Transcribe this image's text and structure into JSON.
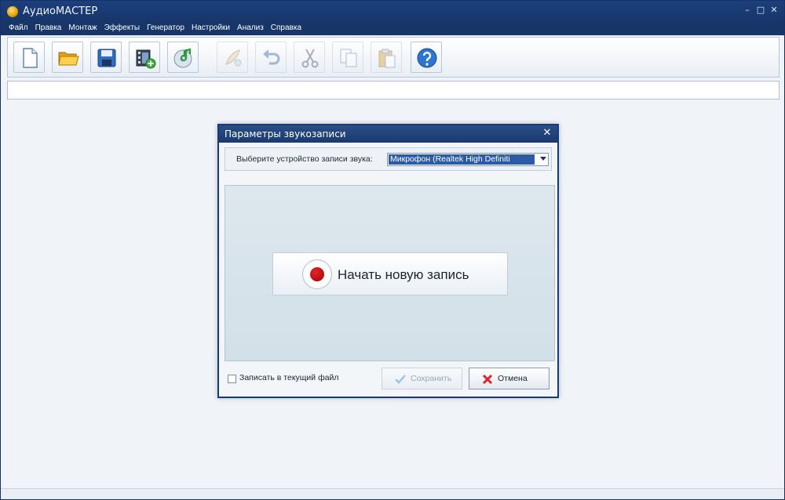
{
  "window": {
    "title": "АудиоМАСТЕР",
    "controls": [
      "–",
      "□",
      "✕"
    ]
  },
  "menu": [
    "Файл",
    "Правка",
    "Монтаж",
    "Эффекты",
    "Генератор",
    "Настройки",
    "Анализ",
    "Справка"
  ],
  "toolbar": {
    "buttons": [
      {
        "icon": "new-file-icon",
        "enabled": true
      },
      {
        "icon": "open-folder-icon",
        "enabled": true
      },
      {
        "icon": "save-disk-icon",
        "enabled": true
      },
      {
        "icon": "video-add-icon",
        "enabled": true
      },
      {
        "icon": "cd-music-icon",
        "enabled": true
      },
      {
        "icon": "audio-effect-icon",
        "enabled": false
      },
      {
        "icon": "undo-icon",
        "enabled": false
      },
      {
        "icon": "cut-icon",
        "enabled": false
      },
      {
        "icon": "copy-icon",
        "enabled": false
      },
      {
        "icon": "paste-icon",
        "enabled": false
      },
      {
        "icon": "help-icon",
        "enabled": true
      }
    ]
  },
  "dialog": {
    "title": "Параметры звукозаписи",
    "close": "✕",
    "device_label": "Выберите устройство записи звука:",
    "device_value": "Микрофон (Realtek High Definiti",
    "record_button": "Начать новую запись",
    "checkbox_label": "Записать в текущий файл",
    "checkbox_checked": false,
    "save_button": "Сохранить",
    "cancel_button": "Отмена"
  },
  "colors": {
    "title_bar": "#1b3f7c",
    "record_red": "#d0181e",
    "selection": "#2b5aa8"
  }
}
